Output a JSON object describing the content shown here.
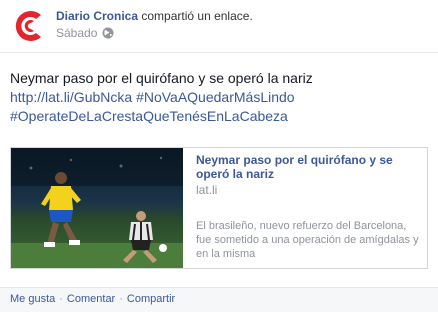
{
  "post": {
    "author": "Diario Cronica",
    "action": "compartió un enlace.",
    "time": "Sábado",
    "text": "Neymar paso por el quirófano y se operó la nariz",
    "link": "http://lat.li/GubNcka",
    "hashtag1": "#NoVaAQuedarMásLindo",
    "hashtag2": "#OperateDeLaCrestaQueTenésEnLaCabeza"
  },
  "card": {
    "title": "Neymar paso por el quirófano y se operó la nariz",
    "domain": "lat.li",
    "description": "El brasileño, nuevo refuerzo del Barcelona, fue sometido a una operación de amígdalas y en la misma"
  },
  "actions": {
    "like": "Me gusta",
    "comment": "Comentar",
    "share": "Compartir",
    "separator": "·"
  },
  "colors": {
    "link": "#3b5998",
    "meta": "#90949c",
    "logo_red": "#e3262e"
  },
  "icons": {
    "avatar": "diario-cronica-logo",
    "privacy": "globe-icon"
  }
}
